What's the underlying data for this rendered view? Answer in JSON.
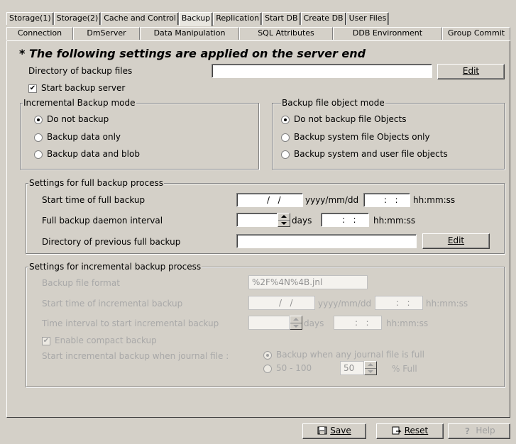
{
  "tabs_row1": [
    "Storage(1)",
    "Storage(2)",
    "Cache and Control",
    "Backup",
    "Replication",
    "Start DB",
    "Create DB",
    "User Files"
  ],
  "tabs_row2": [
    "Connection",
    "DmServer",
    "Data Manipulation",
    "SQL Attributes",
    "DDB Environment",
    "Group Commit"
  ],
  "heading": "* The following settings are applied on the server end",
  "backup_dir": {
    "label": "Directory of backup files",
    "value": "",
    "button": "Edit"
  },
  "start_server": {
    "label": "Start backup server",
    "checked": true
  },
  "incremental_mode": {
    "title": "Incremental Backup mode",
    "options": [
      "Do not backup",
      "Backup data only",
      "Backup data and blob"
    ],
    "selected": 0
  },
  "file_object_mode": {
    "title": "Backup file object mode",
    "options": [
      "Do not backup file Objects",
      "Backup system file Objects only",
      "Backup system and user file objects"
    ],
    "selected": 0
  },
  "full_backup": {
    "title": "Settings for full backup process",
    "start_time_label": "Start time of full backup",
    "date_value": "  /   /",
    "date_format": "yyyy/mm/dd",
    "time_value": "  :   :",
    "time_format": "hh:mm:ss",
    "interval_label": "Full backup daemon interval",
    "days_label": "days",
    "interval_time": "  :   :",
    "interval_format": "hh:mm:ss",
    "prev_dir_label": "Directory of previous full backup",
    "prev_dir_value": "",
    "edit_button": "Edit"
  },
  "incremental_backup": {
    "title": "Settings for incremental backup process",
    "file_format_label": "Backup file format",
    "file_format_value": "%2F%4N%4B.jnl",
    "start_time_label": "Start time of incremental backup",
    "date_value": "  /   /",
    "date_format": "yyyy/mm/dd",
    "time_value": "  :   :",
    "time_format": "hh:mm:ss",
    "interval_label": "Time interval to start incremental backup",
    "days_label": "days",
    "interval_time": "  :   :",
    "interval_format": "hh:mm:ss",
    "compact_label": "Enable compact backup",
    "compact_checked": true,
    "journal_label": "Start incremental backup when journal file :",
    "journal_options": [
      "Backup when any journal file is full",
      "50 - 100"
    ],
    "journal_selected": 0,
    "percent_value": "50",
    "percent_label": "% Full"
  },
  "buttons": {
    "save": "Save",
    "reset": "Reset",
    "help": "Help"
  }
}
